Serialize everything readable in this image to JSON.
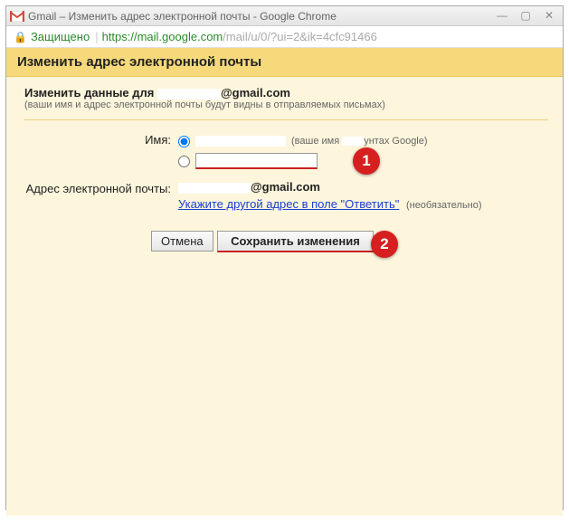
{
  "window": {
    "title": "Gmail – Изменить адрес электронной почты - Google Chrome"
  },
  "addressbar": {
    "secure_label": "Защищено",
    "url_host": "https://mail.google.com",
    "url_path": "/mail/u/0/?ui=2&ik=4cfc91466"
  },
  "page": {
    "heading": "Изменить адрес электронной почты",
    "subtitle_prefix": "Изменить данные для ",
    "subtitle_email_suffix": "@gmail.com",
    "note": "(ваши имя и адрес электронной почты будут видны в отправляемых письмах)"
  },
  "form": {
    "name_label": "Имя:",
    "name_hint_prefix": "(ваше имя ",
    "name_hint_suffix": "унтах Google)",
    "email_label": "Адрес электронной почты:",
    "email_value_suffix": "@gmail.com",
    "reply_link": "Укажите другой адрес в поле \"Ответить\"",
    "reply_optional": "(необязательно)",
    "custom_name_value": ""
  },
  "buttons": {
    "cancel": "Отмена",
    "save": "Сохранить изменения"
  },
  "annotations": {
    "a1": "1",
    "a2": "2"
  }
}
